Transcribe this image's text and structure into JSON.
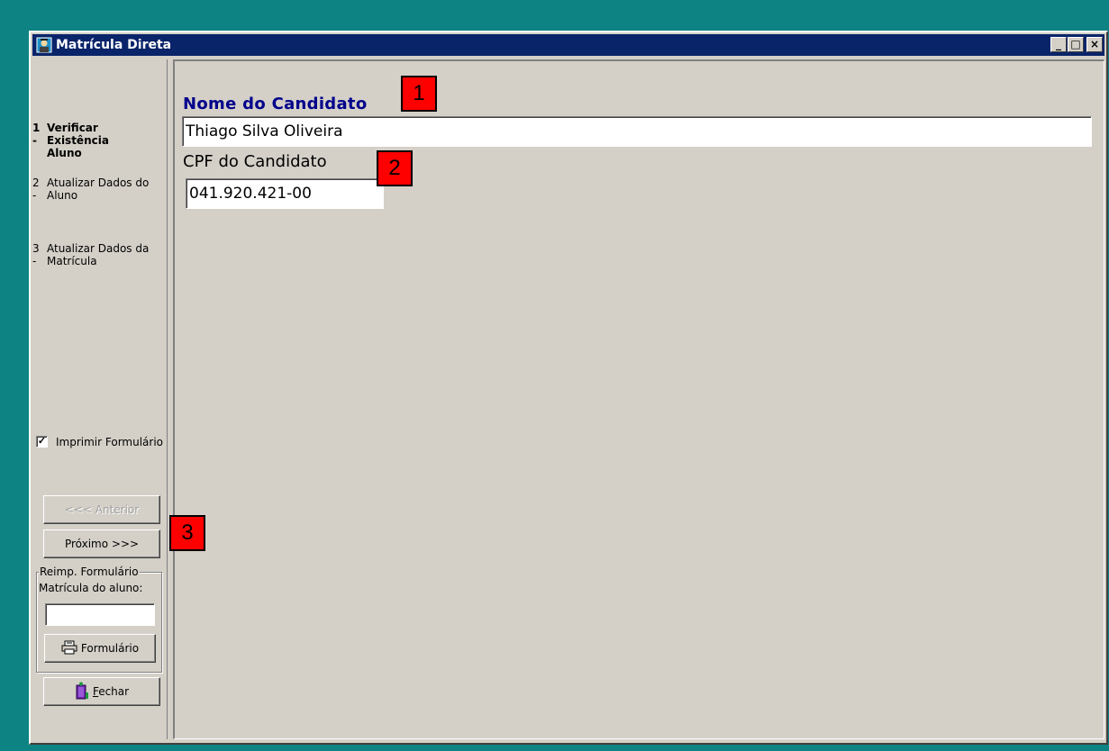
{
  "window": {
    "title": "Matrícula Direta",
    "controls": {
      "minimize": "_",
      "maximize": "□",
      "close": "×"
    }
  },
  "wizard": {
    "steps": [
      {
        "number": "1 -",
        "label": "Verificar Existência Aluno",
        "active": true
      },
      {
        "number": "2 -",
        "label": "Atualizar Dados do Aluno",
        "active": false
      },
      {
        "number": "3 -",
        "label": "Atualizar Dados da Matrícula",
        "active": false
      }
    ],
    "print_form": {
      "label": "Imprimir Formulário",
      "checked": true
    },
    "buttons": {
      "previous": "<<< Anterior",
      "next": "Próximo >>>",
      "form": "Formulário",
      "close": "Fechar",
      "close_accel": "F",
      "close_rest": "echar"
    },
    "reprint_group": {
      "title": "Reimp. Formulário",
      "enrollment_label": "Matrícula do aluno:",
      "enrollment_value": ""
    }
  },
  "form": {
    "name_label": "Nome do Candidato",
    "name_value": "Thiago Silva Oliveira",
    "cpf_label": "CPF do Candidato",
    "cpf_value": "041.920.421-00"
  },
  "annotations": [
    "1",
    "2",
    "3"
  ],
  "colors": {
    "desktop": "#0e8383",
    "titlebar": "#0a246a",
    "face": "#d4d0c8",
    "label_blue": "#00008b",
    "badge": "#ff0000"
  }
}
